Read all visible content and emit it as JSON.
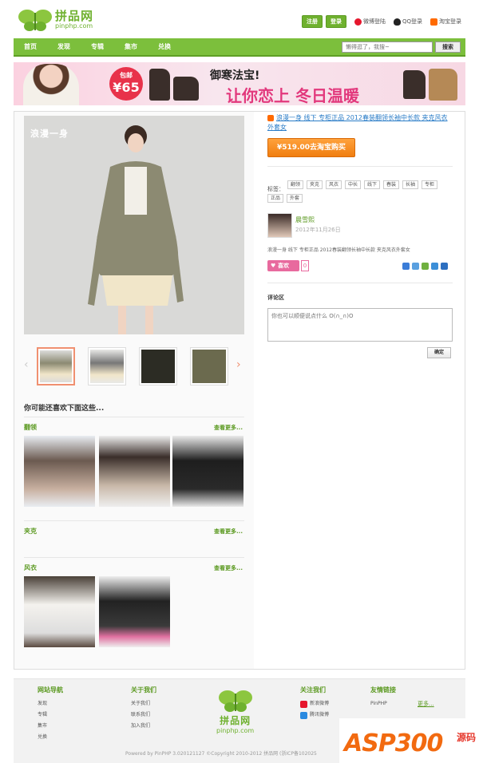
{
  "header": {
    "logo_cn": "拼品网",
    "logo_en": "pinphp.com",
    "register": "注册",
    "login": "登录",
    "weibo_login": "微博登陆",
    "qq_login": "QQ登录",
    "taobao_login": "淘宝登录"
  },
  "nav": {
    "items": [
      "首页",
      "发现",
      "专辑",
      "集市",
      "兑换"
    ],
    "search_placeholder": "懒得逛了，我搜~",
    "search_btn": "搜索"
  },
  "banner": {
    "badge_top": "包邮",
    "badge_price": "¥65",
    "text1": "御寒法宝!",
    "text2": "让你恋上 冬日温暖"
  },
  "product": {
    "brand_watermark": "浪漫一身",
    "title": "浪漫一身 线下 专柜正品 2012春装翻领长袖中长款 夹克风衣外套女",
    "buy_label": "¥519.00去淘宝购买",
    "tags_label": "标签：",
    "tags": [
      "翻领",
      "夹克",
      "风衣",
      "中长",
      "线下",
      "春装",
      "长袖",
      "专柜",
      "正品",
      "外套"
    ],
    "user_name": "晨雪熙",
    "user_date": "2012年11月26日",
    "description": "浪漫一身 线下 专柜正品 2012春装翻领长袖中长款 夹克风衣外套女",
    "like_label": "喜欢",
    "like_count": "0",
    "comment_label": "评论区",
    "comment_placeholder": "你也可以顺便说点什么 O(∩_∩)O",
    "confirm_btn": "确定"
  },
  "related": {
    "heading": "你可能还喜欢下面这些...",
    "more": "查看更多...",
    "sections": [
      {
        "title": "翻领"
      },
      {
        "title": "夹克"
      },
      {
        "title": "风衣"
      }
    ]
  },
  "footer": {
    "cols": [
      {
        "title": "网站导航",
        "links": [
          "发现",
          "专辑",
          "集市",
          "兑换"
        ]
      },
      {
        "title": "关于我们",
        "links": [
          "关于我们",
          "联系我们",
          "加入我们"
        ]
      },
      {
        "title": "关注我们",
        "links": [
          "新浪微博",
          "腾讯微博"
        ]
      },
      {
        "title": "友情链接",
        "links": [
          "PinPHP"
        ]
      }
    ],
    "friend_more": "更多...",
    "logo_cn": "拼品网",
    "logo_en": "pinphp.com",
    "copyright": "Powered by PinPHP 3.020121127 ©Copyright 2010-2012 拼品网 (浙ICP备102025",
    "watermark_text": "ASP300",
    "watermark_cn": "源码"
  },
  "colors": {
    "brand_green": "#7cbf3c",
    "buy_orange": "#f07e10",
    "like_pink": "#e86a9e",
    "link_blue": "#2a7cc7"
  }
}
